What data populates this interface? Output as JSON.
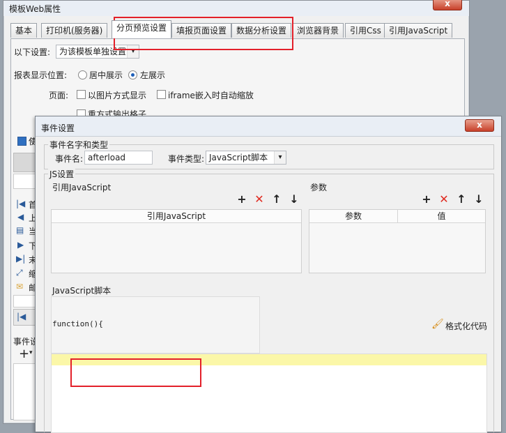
{
  "back_window": {
    "title": "模板Web属性",
    "close_label": "x",
    "tabs": [
      "基本",
      "打印机(服务器)",
      "分页预览设置",
      "填报页面设置",
      "数据分析设置",
      "浏览器背景",
      "引用Css",
      "引用JavaScript"
    ],
    "settings_label": "以下设置:",
    "settings_value": "为该模板单独设置",
    "position_label": "报表显示位置:",
    "position_center": "居中展示",
    "position_left": "左展示",
    "page_label": "页面:",
    "as_image": "以图片方式显示",
    "iframe_zoom": "iframe嵌入时自动缩放",
    "repeat_output": "重方式输出格子",
    "side_fragments": [
      "使",
      "首",
      "上",
      "当",
      "下",
      "末",
      "缩",
      "邮"
    ],
    "event_label": "事件设",
    "add_symbol": "+"
  },
  "dialog": {
    "title": "事件设置",
    "close_label": "x",
    "group_name_type": "事件名字和类型",
    "event_name_label": "事件名:",
    "event_name_value": "afterload",
    "event_type_label": "事件类型:",
    "event_type_value": "JavaScript脚本",
    "group_js": "JS设置",
    "ref_js_label": "引用JavaScript",
    "params_label": "参数",
    "ref_js_column": "引用JavaScript",
    "param_column": "参数",
    "value_column": "值",
    "script_label": "JavaScript脚本",
    "function_text": "function(){",
    "format_code": "格式化代码"
  },
  "colors": {
    "highlight_line": "#fbf7a8",
    "annotation_red": "#e3202a"
  }
}
